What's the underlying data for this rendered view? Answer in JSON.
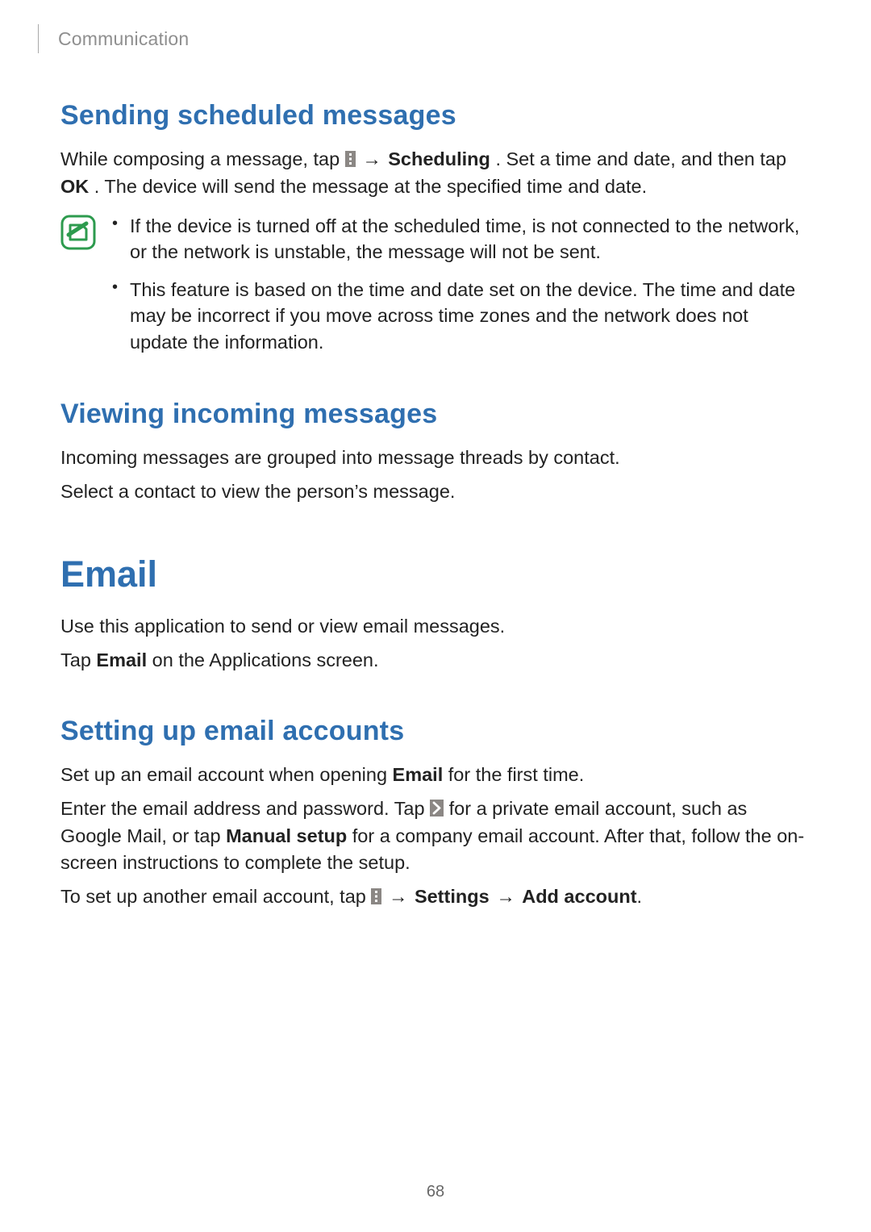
{
  "header": {
    "breadcrumb": "Communication"
  },
  "section1": {
    "heading": "Sending scheduled messages",
    "para_parts": {
      "a": "While composing a message, tap ",
      "arrow1": "→",
      "b_bold": "Scheduling",
      "c": ". Set a time and date, and then tap ",
      "d_bold": "OK",
      "e": ". The device will send the message at the specified time and date."
    },
    "notes": [
      "If the device is turned off at the scheduled time, is not connected to the network, or the network is unstable, the message will not be sent.",
      "This feature is based on the time and date set on the device. The time and date may be incorrect if you move across time zones and the network does not update the information."
    ]
  },
  "section2": {
    "heading": "Viewing incoming messages",
    "p1": "Incoming messages are grouped into message threads by contact.",
    "p2": "Select a contact to view the person’s message."
  },
  "section3": {
    "heading": "Email",
    "p1": "Use this application to send or view email messages.",
    "p2_a": "Tap ",
    "p2_bold": "Email",
    "p2_b": " on the Applications screen."
  },
  "section4": {
    "heading": "Setting up email accounts",
    "p1_a": "Set up an email account when opening ",
    "p1_bold": "Email",
    "p1_b": " for the first time.",
    "p2_a": "Enter the email address and password. Tap ",
    "p2_b": " for a private email account, such as Google Mail, or tap ",
    "p2_bold": "Manual setup",
    "p2_c": " for a company email account. After that, follow the on-screen instructions to complete the setup.",
    "p3_a": "To set up another email account, tap ",
    "arrow1": "→",
    "p3_bold1": "Settings",
    "arrow2": "→",
    "p3_bold2": "Add account",
    "p3_end": "."
  },
  "page_number": "68",
  "icons": {
    "menu": "menu-icon",
    "next": "next-icon",
    "note": "note-icon"
  }
}
